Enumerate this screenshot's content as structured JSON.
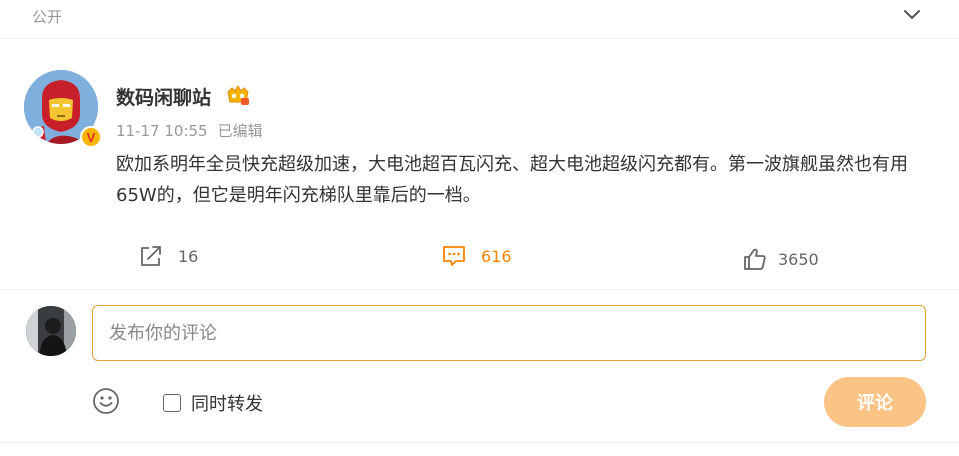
{
  "visibility": "公开",
  "post": {
    "author": "数码闲聊站",
    "timestamp": "11-17 10:55",
    "edited": "已编辑",
    "text": "欧加系明年全员快充超级加速，大电池超百瓦闪充、超大电池超级闪充都有。第一波旗舰虽然也有用65W的，但它是明年闪充梯队里靠后的一档。",
    "verified_badge": "V",
    "actions": {
      "share_count": "16",
      "comment_count": "616",
      "like_count": "3650"
    },
    "icons": {
      "share": "share-icon",
      "comment": "comment-icon",
      "like": "thumbs-up-icon",
      "collapse": "chevron-down-icon",
      "vip": "vip-crown-icon"
    }
  },
  "comment_box": {
    "placeholder": "发布你的评论",
    "repost_label": "同时转发",
    "submit_label": "评论",
    "emoji_icon": "smiley-icon"
  },
  "colors": {
    "accent": "#ff8200",
    "input_border": "#e5a23d",
    "submit_disabled": "#fcc387",
    "muted_text": "#999999"
  }
}
